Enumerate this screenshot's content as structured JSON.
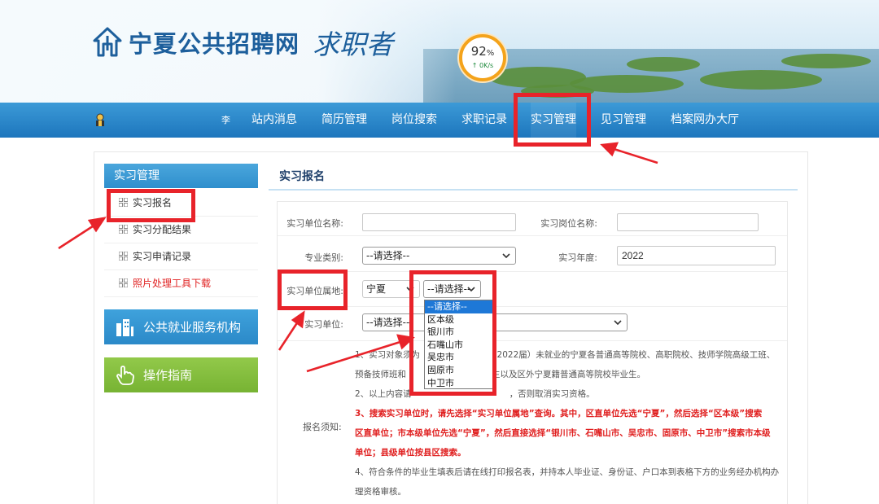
{
  "header": {
    "site_name": "宁夏公共招聘网",
    "site_sub": "求职者",
    "speed_pct": "92",
    "speed_unit": "%",
    "speed_rate": "0K/s"
  },
  "nav": {
    "welcome": "李",
    "items": [
      {
        "label": "站内消息"
      },
      {
        "label": "简历管理"
      },
      {
        "label": "岗位搜索"
      },
      {
        "label": "求职记录"
      },
      {
        "label": "实习管理",
        "active": true
      },
      {
        "label": "见习管理"
      },
      {
        "label": "档案网办大厅"
      }
    ]
  },
  "sidebar": {
    "title": "实习管理",
    "items": [
      {
        "label": "实习报名"
      },
      {
        "label": "实习分配结果"
      },
      {
        "label": "实习申请记录"
      },
      {
        "label": "照片处理工具下载"
      }
    ],
    "service_org": "公共就业服务机构",
    "guide": "操作指南"
  },
  "main": {
    "title": "实习报名",
    "form": {
      "unit_name_label": "实习单位名称:",
      "unit_name_value": "",
      "post_name_label": "实习岗位名称:",
      "post_name_value": "",
      "major_label": "专业类别:",
      "major_value": "--请选择--",
      "year_label": "实习年度:",
      "year_value": "2022",
      "location_label": "实习单位属地:",
      "location_value": "宁夏",
      "location_sub_value": "--请选择--",
      "unit_label": "实习单位:",
      "unit_value": "--请选择--",
      "notes_label": "报名须知:"
    },
    "dropdown_options": [
      "--请选择--",
      "区本级",
      "银川市",
      "石嘴山市",
      "吴忠市",
      "固原市",
      "中卫市"
    ],
    "notes": {
      "n1a": "1、实习对象须为",
      "n1b": "21届、2022届）未就业的宁夏各普通高等院校、高职院校、技师学院高级工班、",
      "n1c": "预备技师班和",
      "n1d": "毕业生以及区外宁夏籍普通高等院校毕业生。",
      "n2a": "2、以上内容请",
      "n2b": "，否则取消实习资格。",
      "n3a": "3、搜索实习单位时，请先选择“实习单位属地”查询。其中，区直单位先选“宁夏”，然后选择“区本级”搜索",
      "n3b": "区直单位；市本级单位先选“宁夏”，然后直接选择“银川市、石嘴山市、吴忠市、固原市、中卫市”搜索市本级",
      "n3c": "单位；县级单位按县区搜索。",
      "n4a": "4、符合条件的毕业生填表后请在线打印报名表，并持本人毕业证、身份证、户口本到表格下方的业务经办机构办",
      "n4b": "理资格审核。"
    }
  },
  "colors": {
    "nav_blue": "#1d76bd",
    "highlight_red": "#e8232a",
    "sidebar_blue": "#2f8fcd",
    "sidebar_green": "#77b333"
  }
}
